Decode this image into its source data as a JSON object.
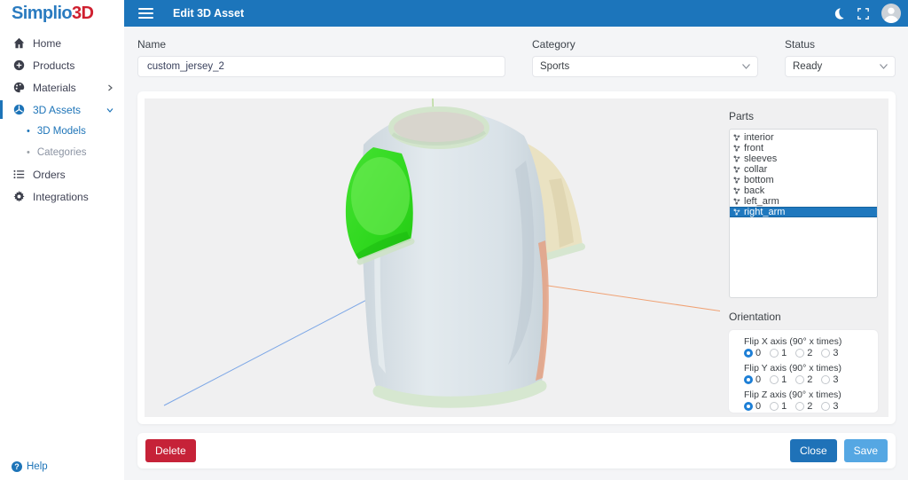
{
  "logo": {
    "part1": "Simplio",
    "part2": "3D"
  },
  "topbar": {
    "title": "Edit 3D Asset"
  },
  "sidebar": {
    "items": [
      {
        "label": "Home"
      },
      {
        "label": "Products"
      },
      {
        "label": "Materials"
      },
      {
        "label": "3D Assets"
      },
      {
        "label": "3D Models"
      },
      {
        "label": "Categories"
      },
      {
        "label": "Orders"
      },
      {
        "label": "Integrations"
      }
    ],
    "help_label": "Help"
  },
  "form": {
    "name": {
      "label": "Name",
      "value": "custom_jersey_2"
    },
    "category": {
      "label": "Category",
      "value": "Sports"
    },
    "status": {
      "label": "Status",
      "value": "Ready"
    }
  },
  "parts": {
    "title": "Parts",
    "items": [
      "interior",
      "front",
      "sleeves",
      "collar",
      "bottom",
      "back",
      "left_arm",
      "right_arm"
    ],
    "selected": "right_arm"
  },
  "orientation": {
    "title": "Orientation",
    "groups": [
      {
        "label": "Flip X axis (90° x times)",
        "selected": "0"
      },
      {
        "label": "Flip Y axis (90° x times)",
        "selected": "0"
      },
      {
        "label": "Flip Z axis (90° x times)",
        "selected": "0"
      }
    ],
    "options": [
      "0",
      "1",
      "2",
      "3"
    ]
  },
  "footer": {
    "delete_label": "Delete",
    "close_label": "Close",
    "save_label": "Save"
  },
  "colors": {
    "topbar": "#1c75bb",
    "accent": "#1d74b8",
    "selected_row": "#1f78be",
    "logo_red": "#cf2030",
    "delete": "#c62238",
    "close": "#1f72b8",
    "save": "#55a7e3",
    "part_highlight_green": "#35dd25",
    "sleeve_beige": "#eae2c2",
    "viewer_bg": "#f0f0f1"
  }
}
